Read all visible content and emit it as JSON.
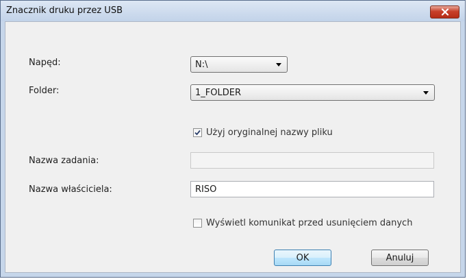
{
  "window": {
    "title": "Znacznik druku przez USB",
    "close_icon": "close-x-icon"
  },
  "fields": {
    "drive_label": "Napęd:",
    "drive_value": "N:\\",
    "folder_label": "Folder:",
    "folder_value": "1_FOLDER",
    "use_original_name": {
      "label": "Użyj oryginalnej nazwy pliku",
      "checked": true
    },
    "job_name_label": "Nazwa zadania:",
    "job_name_value": "",
    "owner_label": "Nazwa właściciela:",
    "owner_value": "RISO",
    "show_message": {
      "label": "Wyświetl komunikat przed usunięciem danych",
      "checked": false
    }
  },
  "buttons": {
    "ok": "OK",
    "cancel": "Anuluj"
  },
  "colors": {
    "default_button": "#bee6fd",
    "close_button": "#c7402a"
  }
}
